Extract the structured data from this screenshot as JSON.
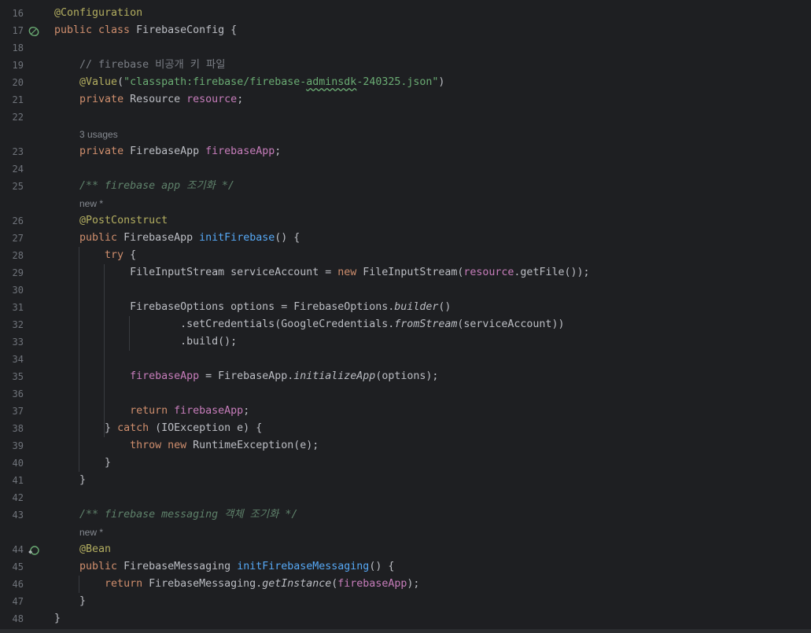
{
  "editor": {
    "lines": [
      {
        "num": "16",
        "tokens": [
          {
            "t": "@Configuration",
            "c": "ann"
          }
        ]
      },
      {
        "num": "17",
        "gutter_icon": "bean-icon",
        "tokens": [
          {
            "t": "public class ",
            "c": "kw"
          },
          {
            "t": "FirebaseConfig {"
          }
        ]
      },
      {
        "num": "18",
        "tokens": []
      },
      {
        "num": "19",
        "tokens": [
          {
            "t": "    "
          },
          {
            "t": "// firebase 비공개 키 파일",
            "c": "cmt"
          }
        ]
      },
      {
        "num": "20",
        "tokens": [
          {
            "t": "    "
          },
          {
            "t": "@Value",
            "c": "ann"
          },
          {
            "t": "("
          },
          {
            "t": "\"classpath:firebase/firebase-",
            "c": "str"
          },
          {
            "t": "adminsdk",
            "c": "str squig"
          },
          {
            "t": "-240325.json\"",
            "c": "str"
          },
          {
            "t": ")"
          }
        ]
      },
      {
        "num": "21",
        "tokens": [
          {
            "t": "    "
          },
          {
            "t": "private ",
            "c": "kw"
          },
          {
            "t": "Resource "
          },
          {
            "t": "resource",
            "c": "fld"
          },
          {
            "t": ";"
          }
        ]
      },
      {
        "num": "22",
        "tokens": []
      },
      {
        "hint": "3 usages"
      },
      {
        "num": "23",
        "tokens": [
          {
            "t": "    "
          },
          {
            "t": "private ",
            "c": "kw"
          },
          {
            "t": "FirebaseApp "
          },
          {
            "t": "firebaseApp",
            "c": "fld"
          },
          {
            "t": ";"
          }
        ]
      },
      {
        "num": "24",
        "tokens": []
      },
      {
        "num": "25",
        "tokens": [
          {
            "t": "    "
          },
          {
            "t": "/** firebase app 조기화 */",
            "c": "doc"
          }
        ]
      },
      {
        "hint": "new *"
      },
      {
        "num": "26",
        "tokens": [
          {
            "t": "    "
          },
          {
            "t": "@PostConstruct",
            "c": "ann"
          }
        ]
      },
      {
        "num": "27",
        "tokens": [
          {
            "t": "    "
          },
          {
            "t": "public ",
            "c": "kw"
          },
          {
            "t": "FirebaseApp "
          },
          {
            "t": "initFirebase",
            "c": "fn"
          },
          {
            "t": "() {"
          }
        ]
      },
      {
        "num": "28",
        "tokens": [
          {
            "t": "        "
          },
          {
            "t": "try ",
            "c": "kw"
          },
          {
            "t": "{"
          }
        ]
      },
      {
        "num": "29",
        "tokens": [
          {
            "t": "            FileInputStream serviceAccount = "
          },
          {
            "t": "new ",
            "c": "kw"
          },
          {
            "t": "FileInputStream("
          },
          {
            "t": "resource",
            "c": "fld"
          },
          {
            "t": ".getFile());"
          }
        ]
      },
      {
        "num": "30",
        "tokens": []
      },
      {
        "num": "31",
        "tokens": [
          {
            "t": "            FirebaseOptions options = FirebaseOptions."
          },
          {
            "t": "builder",
            "c": "it"
          },
          {
            "t": "()"
          }
        ]
      },
      {
        "num": "32",
        "tokens": [
          {
            "t": "                    .setCredentials(GoogleCredentials."
          },
          {
            "t": "fromStream",
            "c": "it"
          },
          {
            "t": "(serviceAccount))"
          }
        ]
      },
      {
        "num": "33",
        "tokens": [
          {
            "t": "                    .build();"
          }
        ]
      },
      {
        "num": "34",
        "tokens": []
      },
      {
        "num": "35",
        "tokens": [
          {
            "t": "            "
          },
          {
            "t": "firebaseApp",
            "c": "fld"
          },
          {
            "t": " = FirebaseApp."
          },
          {
            "t": "initializeApp",
            "c": "it"
          },
          {
            "t": "(options);"
          }
        ]
      },
      {
        "num": "36",
        "tokens": []
      },
      {
        "num": "37",
        "tokens": [
          {
            "t": "            "
          },
          {
            "t": "return ",
            "c": "kw"
          },
          {
            "t": "firebaseApp",
            "c": "fld"
          },
          {
            "t": ";"
          }
        ]
      },
      {
        "num": "38",
        "tokens": [
          {
            "t": "        } "
          },
          {
            "t": "catch ",
            "c": "kw"
          },
          {
            "t": "(IOException e) {"
          }
        ]
      },
      {
        "num": "39",
        "tokens": [
          {
            "t": "            "
          },
          {
            "t": "throw new ",
            "c": "kw"
          },
          {
            "t": "RuntimeException(e);"
          }
        ]
      },
      {
        "num": "40",
        "tokens": [
          {
            "t": "        }"
          }
        ]
      },
      {
        "num": "41",
        "tokens": [
          {
            "t": "    }"
          }
        ]
      },
      {
        "num": "42",
        "tokens": []
      },
      {
        "num": "43",
        "tokens": [
          {
            "t": "    "
          },
          {
            "t": "/** firebase messaging 객체 조기화 */",
            "c": "doc"
          }
        ]
      },
      {
        "hint": "new *"
      },
      {
        "num": "44",
        "gutter_icon": "bean-method-icon",
        "tokens": [
          {
            "t": "    "
          },
          {
            "t": "@Bean",
            "c": "ann"
          }
        ]
      },
      {
        "num": "45",
        "tokens": [
          {
            "t": "    "
          },
          {
            "t": "public ",
            "c": "kw"
          },
          {
            "t": "FirebaseMessaging "
          },
          {
            "t": "initFirebaseMessaging",
            "c": "fn"
          },
          {
            "t": "() {"
          }
        ]
      },
      {
        "num": "46",
        "tokens": [
          {
            "t": "        "
          },
          {
            "t": "return ",
            "c": "kw"
          },
          {
            "t": "FirebaseMessaging."
          },
          {
            "t": "getInstance",
            "c": "it"
          },
          {
            "t": "("
          },
          {
            "t": "firebaseApp",
            "c": "fld"
          },
          {
            "t": ");"
          }
        ]
      },
      {
        "num": "47",
        "tokens": [
          {
            "t": "    }"
          }
        ]
      },
      {
        "num": "48",
        "tokens": [
          {
            "t": "}"
          }
        ]
      }
    ]
  }
}
